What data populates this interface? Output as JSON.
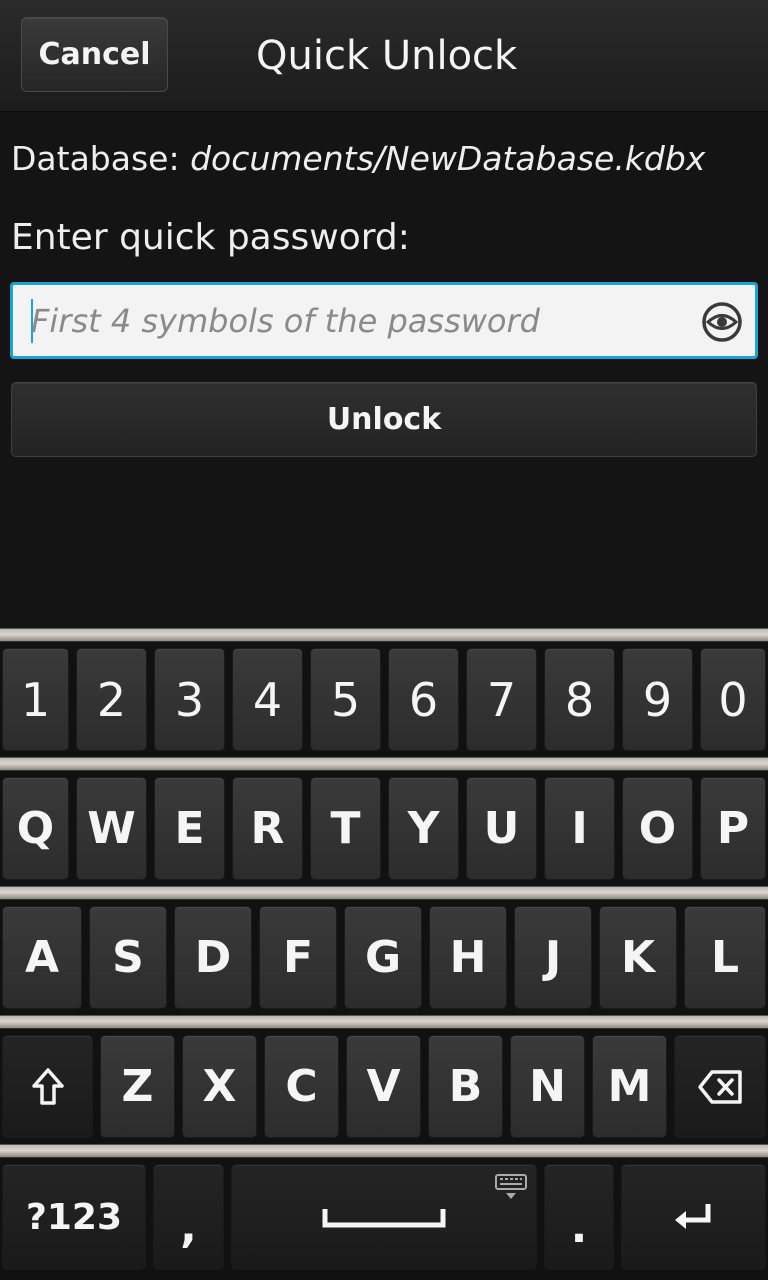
{
  "header": {
    "cancel_label": "Cancel",
    "title": "Quick Unlock"
  },
  "database": {
    "label": "Database:",
    "value": "documents/NewDatabase.kdbx"
  },
  "prompt": "Enter quick password:",
  "password_field": {
    "value": "",
    "placeholder": "First 4 symbols of the password",
    "icon": "eye-icon"
  },
  "unlock_label": "Unlock",
  "accent_color": "#1aa3d8",
  "keyboard": {
    "row1": [
      "1",
      "2",
      "3",
      "4",
      "5",
      "6",
      "7",
      "8",
      "9",
      "0"
    ],
    "row2": [
      "Q",
      "W",
      "E",
      "R",
      "T",
      "Y",
      "U",
      "I",
      "O",
      "P"
    ],
    "row3": [
      "A",
      "S",
      "D",
      "F",
      "G",
      "H",
      "J",
      "K",
      "L"
    ],
    "row4": [
      "Z",
      "X",
      "C",
      "V",
      "B",
      "N",
      "M"
    ],
    "symbols_label": "?123",
    "comma_label": ",",
    "period_label": ".",
    "icons": [
      "shift-icon",
      "backspace-icon",
      "space-icon",
      "keyboard-hide-icon",
      "enter-icon"
    ]
  }
}
